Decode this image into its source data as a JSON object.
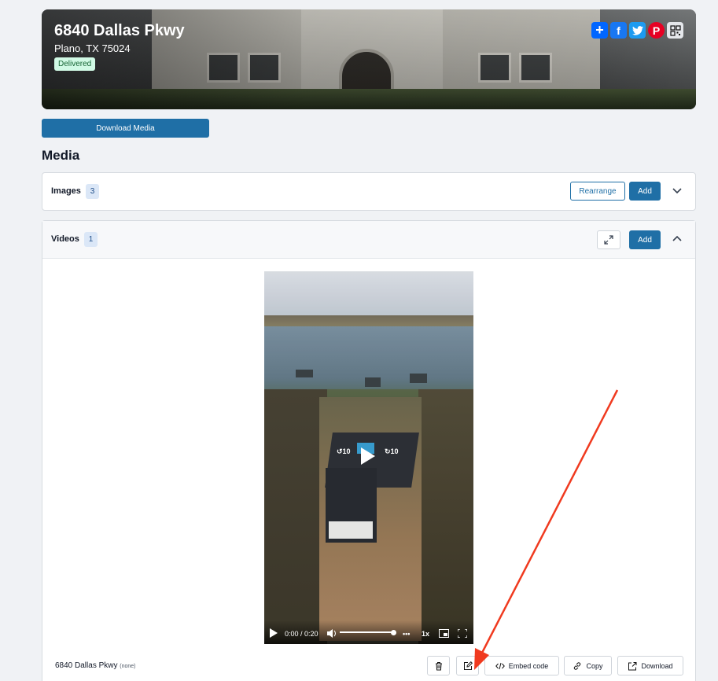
{
  "listing": {
    "address": "6840 Dallas Pkwy",
    "city_line": "Plano, TX 75024",
    "status": "Delivered"
  },
  "share_icons": [
    "share-plus-icon",
    "facebook-icon",
    "twitter-icon",
    "pinterest-icon",
    "qr-code-icon"
  ],
  "download_media_label": "Download Media",
  "media_heading": "Media",
  "images_panel": {
    "label": "Images",
    "count": "3",
    "rearrange_label": "Rearrange",
    "add_label": "Add"
  },
  "videos_panel": {
    "label": "Videos",
    "count": "1",
    "add_label": "Add"
  },
  "video_player": {
    "time": "0:00 / 0:20",
    "speed": "1x",
    "skip_back": "10",
    "skip_forward": "10",
    "volume_fraction": 0.95
  },
  "video_item": {
    "name": "6840 Dallas Pkwy",
    "note": "(none)",
    "embed_label": "Embed code",
    "copy_label": "Copy",
    "download_label": "Download"
  },
  "colors": {
    "primary": "#1f6fa6",
    "annotation_arrow": "#f03a1f"
  }
}
